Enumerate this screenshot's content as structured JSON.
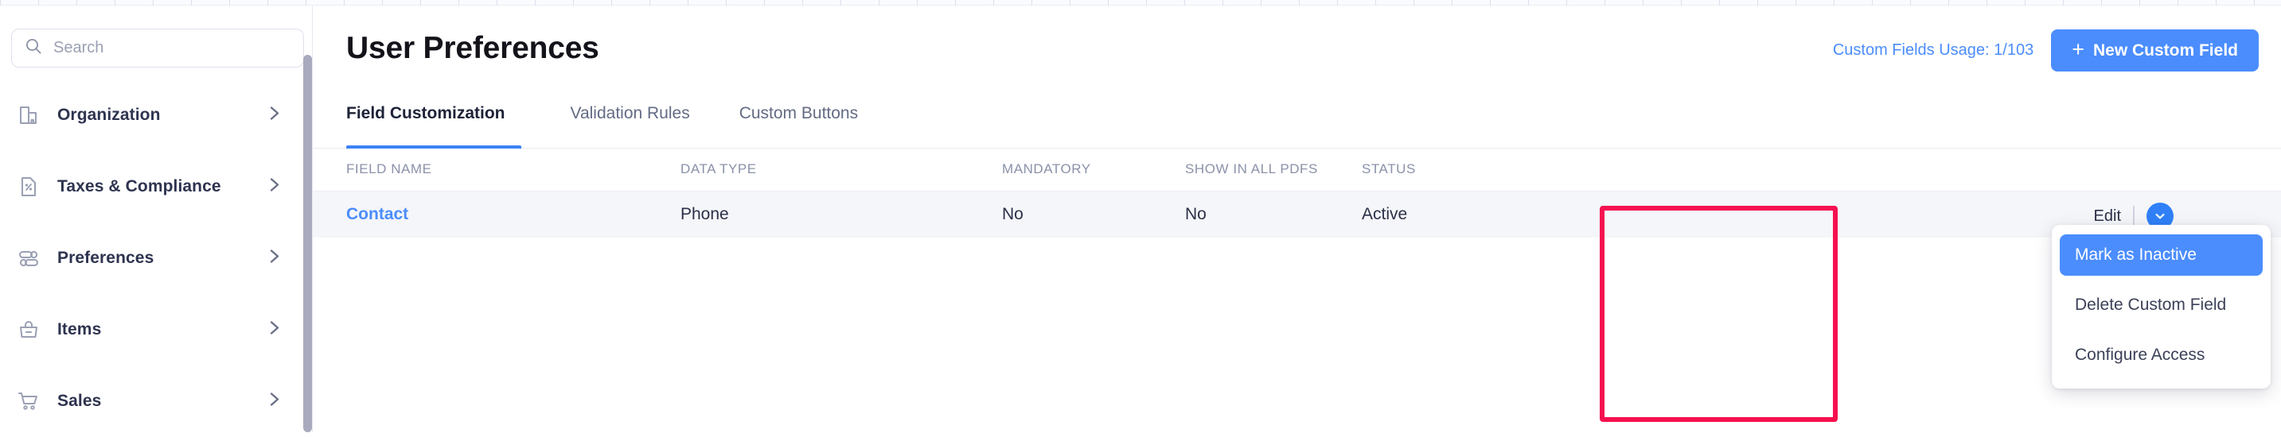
{
  "colors": {
    "accent": "#4b8dfd",
    "accent_button": "#2f80f7",
    "annotation": "#f5114f",
    "row_bg": "#f5f6f9",
    "text_dark": "#2b3047",
    "text_muted": "#8b91a9"
  },
  "sidebar": {
    "search": {
      "placeholder": "Search",
      "value": "",
      "icon": "search-icon"
    },
    "items": [
      {
        "label": "Organization",
        "icon": "organization-icon",
        "arrow": "chevron-right-icon"
      },
      {
        "label": "Taxes & Compliance",
        "icon": "tax-document-icon",
        "arrow": "chevron-right-icon"
      },
      {
        "label": "Preferences",
        "icon": "sliders-icon",
        "arrow": "chevron-right-icon"
      },
      {
        "label": "Items",
        "icon": "bag-icon",
        "arrow": "chevron-right-icon"
      },
      {
        "label": "Sales",
        "icon": "shopping-cart-icon",
        "arrow": "chevron-right-icon"
      }
    ],
    "scrollbar": "vertical-scrollbar"
  },
  "header": {
    "title": "User Preferences",
    "usage_label": "Custom Fields Usage: 1/103",
    "new_field_button": "New Custom Field",
    "plus_glyph": "+"
  },
  "tabs": [
    {
      "label": "Field Customization",
      "active": true
    },
    {
      "label": "Validation Rules",
      "active": false
    },
    {
      "label": "Custom Buttons",
      "active": false
    }
  ],
  "table": {
    "columns": [
      "FIELD NAME",
      "DATA TYPE",
      "MANDATORY",
      "SHOW IN ALL PDFS",
      "STATUS"
    ],
    "rows": [
      {
        "field_name": "Contact",
        "data_type": "Phone",
        "mandatory": "No",
        "show_in_all_pdfs": "No",
        "status": "Active"
      }
    ]
  },
  "row_actions": {
    "edit_label": "Edit",
    "caret_icon": "chevron-down-icon",
    "menu": [
      {
        "label": "Mark as Inactive",
        "selected": true
      },
      {
        "label": "Delete Custom Field",
        "selected": false
      },
      {
        "label": "Configure Access",
        "selected": false
      }
    ]
  },
  "annotation": {
    "shape": "rectangle-highlight"
  }
}
